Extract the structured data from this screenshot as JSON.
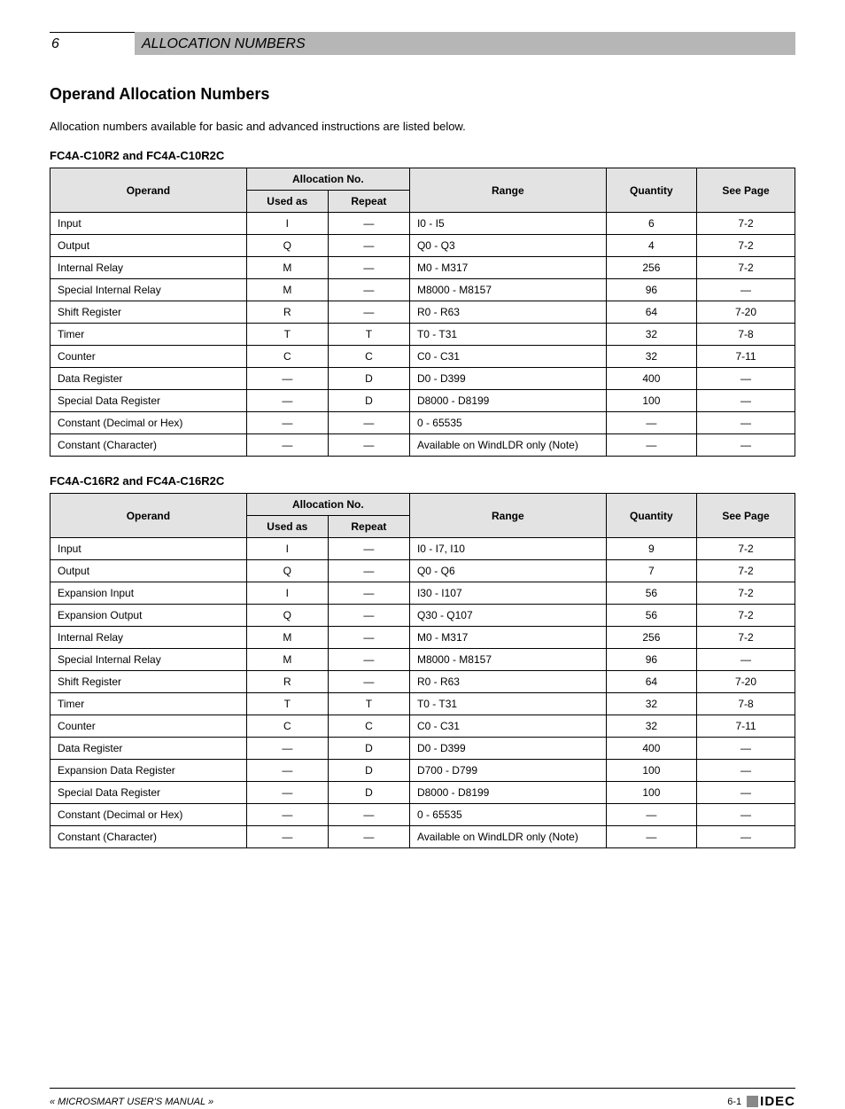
{
  "header": {
    "chapter_no": "6",
    "chapter_title": "ALLOCATION NUMBERS"
  },
  "section_title": "Operand Allocation Numbers",
  "intro_text": "Allocation numbers available for basic and advanced instructions are listed below.",
  "tables": [
    {
      "subheading": "FC4A-C10R2 and FC4A-C10R2C",
      "headers": {
        "operand": "Operand",
        "allocation": "Allocation No.",
        "used_as": "Used as",
        "repeat": "Repeat",
        "range": "Range",
        "quantity": "Quantity",
        "see_page": "See Page"
      },
      "rows": [
        {
          "operand": "Input",
          "used_as": "I",
          "repeat": "—",
          "range": "I0 - I5",
          "quantity": "6",
          "see_page": "7-2"
        },
        {
          "operand": "Output",
          "used_as": "Q",
          "repeat": "—",
          "range": "Q0 - Q3",
          "quantity": "4",
          "see_page": "7-2"
        },
        {
          "operand": "Internal Relay",
          "used_as": "M",
          "repeat": "—",
          "range": "M0 - M317",
          "quantity": "256",
          "see_page": "7-2"
        },
        {
          "operand": "Special Internal Relay",
          "used_as": "M",
          "repeat": "—",
          "range": "M8000 - M8157",
          "quantity": "96",
          "see_page": "—"
        },
        {
          "operand": "Shift Register",
          "used_as": "R",
          "repeat": "—",
          "range": "R0 - R63",
          "quantity": "64",
          "see_page": "7-20"
        },
        {
          "operand": "Timer",
          "used_as": "T",
          "repeat": "T",
          "range": "T0 - T31",
          "quantity": "32",
          "see_page": "7-8"
        },
        {
          "operand": "Counter",
          "used_as": "C",
          "repeat": "C",
          "range": "C0 - C31",
          "quantity": "32",
          "see_page": "7-11"
        },
        {
          "operand": "Data Register",
          "used_as": "—",
          "repeat": "D",
          "range": "D0 - D399",
          "quantity": "400",
          "see_page": "—"
        },
        {
          "operand": "Special Data Register",
          "used_as": "—",
          "repeat": "D",
          "range": "D8000 - D8199",
          "quantity": "100",
          "see_page": "—"
        },
        {
          "operand": "Constant (Decimal or Hex)",
          "used_as": "—",
          "repeat": "—",
          "range": "0 - 65535",
          "quantity": "—",
          "see_page": "—"
        },
        {
          "operand": "Constant (Character)",
          "used_as": "—",
          "repeat": "—",
          "range": "Available on WindLDR only (Note)",
          "quantity": "—",
          "see_page": "—"
        }
      ]
    },
    {
      "subheading": "FC4A-C16R2 and FC4A-C16R2C",
      "headers": {
        "operand": "Operand",
        "allocation": "Allocation No.",
        "used_as": "Used as",
        "repeat": "Repeat",
        "range": "Range",
        "quantity": "Quantity",
        "see_page": "See Page"
      },
      "rows": [
        {
          "operand": "Input",
          "used_as": "I",
          "repeat": "—",
          "range": "I0 - I7, I10",
          "quantity": "9",
          "see_page": "7-2"
        },
        {
          "operand": "Output",
          "used_as": "Q",
          "repeat": "—",
          "range": "Q0 - Q6",
          "quantity": "7",
          "see_page": "7-2"
        },
        {
          "operand": "Expansion Input",
          "used_as": "I",
          "repeat": "—",
          "range": "I30 - I107",
          "quantity": "56",
          "see_page": "7-2"
        },
        {
          "operand": "Expansion Output",
          "used_as": "Q",
          "repeat": "—",
          "range": "Q30 - Q107",
          "quantity": "56",
          "see_page": "7-2"
        },
        {
          "operand": "Internal Relay",
          "used_as": "M",
          "repeat": "—",
          "range": "M0 - M317",
          "quantity": "256",
          "see_page": "7-2"
        },
        {
          "operand": "Special Internal Relay",
          "used_as": "M",
          "repeat": "—",
          "range": "M8000 - M8157",
          "quantity": "96",
          "see_page": "—"
        },
        {
          "operand": "Shift Register",
          "used_as": "R",
          "repeat": "—",
          "range": "R0 - R63",
          "quantity": "64",
          "see_page": "7-20"
        },
        {
          "operand": "Timer",
          "used_as": "T",
          "repeat": "T",
          "range": "T0 - T31",
          "quantity": "32",
          "see_page": "7-8"
        },
        {
          "operand": "Counter",
          "used_as": "C",
          "repeat": "C",
          "range": "C0 - C31",
          "quantity": "32",
          "see_page": "7-11"
        },
        {
          "operand": "Data Register",
          "used_as": "—",
          "repeat": "D",
          "range": "D0 - D399",
          "quantity": "400",
          "see_page": "—"
        },
        {
          "operand": "Expansion Data Register",
          "used_as": "—",
          "repeat": "D",
          "range": "D700 - D799",
          "quantity": "100",
          "see_page": "—"
        },
        {
          "operand": "Special Data Register",
          "used_as": "—",
          "repeat": "D",
          "range": "D8000 - D8199",
          "quantity": "100",
          "see_page": "—"
        },
        {
          "operand": "Constant (Decimal or Hex)",
          "used_as": "—",
          "repeat": "—",
          "range": "0 - 65535",
          "quantity": "—",
          "see_page": "—"
        },
        {
          "operand": "Constant (Character)",
          "used_as": "—",
          "repeat": "—",
          "range": "Available on WindLDR only (Note)",
          "quantity": "—",
          "see_page": "—"
        }
      ]
    }
  ],
  "footer": {
    "left": "« MICROSMART USER'S MANUAL »",
    "page": "6-1",
    "logo_text": "IDEC"
  }
}
